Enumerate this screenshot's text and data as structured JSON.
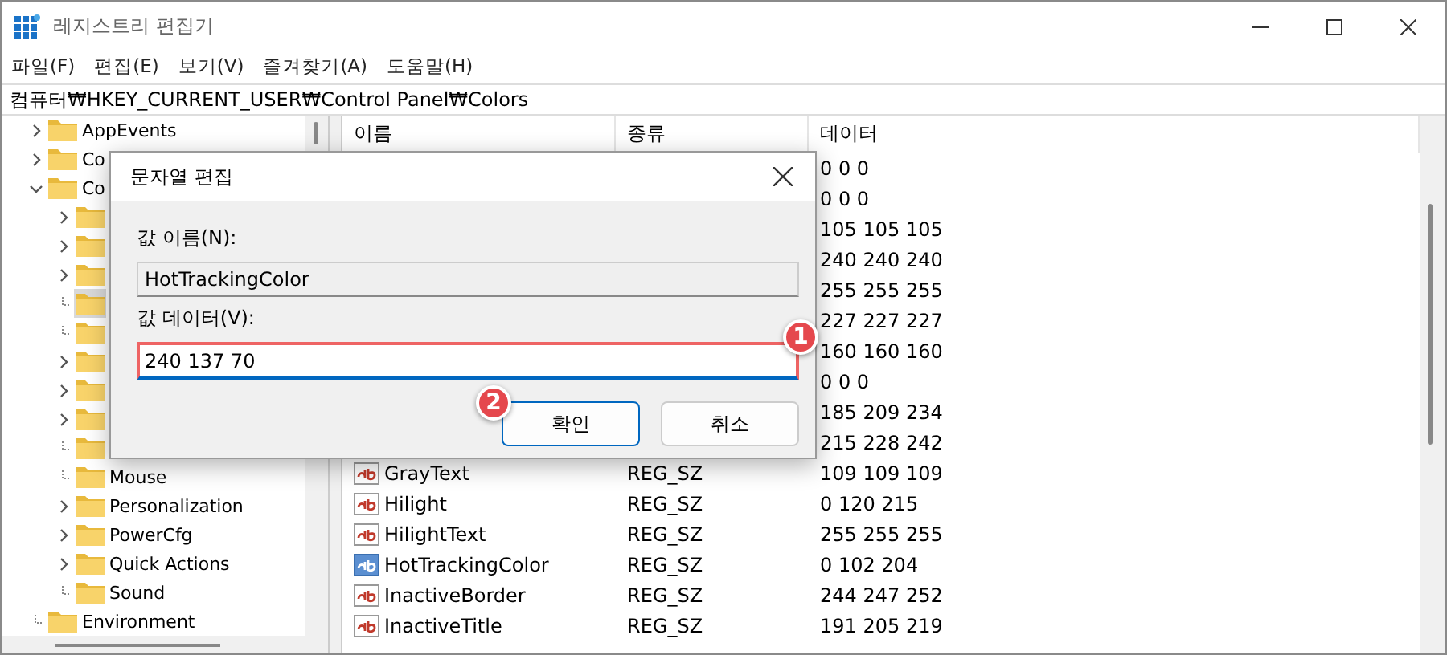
{
  "window": {
    "title": "레지스트리 편집기"
  },
  "menu": [
    "파일(F)",
    "편집(E)",
    "보기(V)",
    "즐겨찾기(A)",
    "도움말(H)"
  ],
  "address": "컴퓨터₩HKEY_CURRENT_USER₩Control Panel₩Colors",
  "tree": [
    {
      "label": "AppEvents",
      "expandable": true,
      "expanded": false,
      "selected": false
    },
    {
      "label": "Co",
      "expandable": true,
      "expanded": false,
      "selected": false
    },
    {
      "label": "Co",
      "expandable": true,
      "expanded": true,
      "selected": false,
      "children": [
        {
          "expandable": true,
          "expanded": false,
          "selected": false
        },
        {
          "expandable": true,
          "expanded": false,
          "selected": false
        },
        {
          "expandable": true,
          "expanded": false,
          "selected": false
        },
        {
          "expandable": false,
          "selected": true
        },
        {
          "expandable": false,
          "selected": false
        },
        {
          "expandable": true,
          "expanded": false,
          "selected": false
        },
        {
          "expandable": true,
          "expanded": false,
          "selected": false
        },
        {
          "expandable": true,
          "expanded": false,
          "selected": false
        },
        {
          "expandable": false,
          "selected": false
        },
        {
          "label": "Mouse",
          "expandable": false,
          "selected": false
        },
        {
          "label": "Personalization",
          "expandable": true,
          "expanded": false,
          "selected": false
        },
        {
          "label": "PowerCfg",
          "expandable": true,
          "expanded": false,
          "selected": false
        },
        {
          "label": "Quick Actions",
          "expandable": true,
          "expanded": false,
          "selected": false
        },
        {
          "label": "Sound",
          "expandable": false,
          "selected": false
        }
      ]
    },
    {
      "label": "Environment",
      "expandable": false,
      "selected": false
    }
  ],
  "table": {
    "columns": [
      "이름",
      "종류",
      "데이터"
    ],
    "rows": [
      {
        "data": "0 0 0"
      },
      {
        "data": "0 0 0"
      },
      {
        "data": "105 105 105"
      },
      {
        "data": "240 240 240"
      },
      {
        "data": "255 255 255"
      },
      {
        "data": "227 227 227"
      },
      {
        "data": "160 160 160"
      },
      {
        "data": "0 0 0"
      },
      {
        "data": "185 209 234"
      },
      {
        "data": "215 228 242"
      },
      {
        "name": "GrayText",
        "type": "REG_SZ",
        "data": "109 109 109",
        "selected": false
      },
      {
        "name": "Hilight",
        "type": "REG_SZ",
        "data": "0 120 215",
        "selected": false
      },
      {
        "name": "HilightText",
        "type": "REG_SZ",
        "data": "255 255 255",
        "selected": false
      },
      {
        "name": "HotTrackingColor",
        "type": "REG_SZ",
        "data": "0 102 204",
        "selected": true
      },
      {
        "name": "InactiveBorder",
        "type": "REG_SZ",
        "data": "244 247 252",
        "selected": false
      },
      {
        "name": "InactiveTitle",
        "type": "REG_SZ",
        "data": "191 205 219",
        "selected": false
      }
    ]
  },
  "dialog": {
    "title": "문자열 편집",
    "name_label": "값 이름(N):",
    "name_value": "HotTrackingColor",
    "data_label": "값 데이터(V):",
    "data_value": "240 137 70",
    "buttons": [
      {
        "label": "확인",
        "default": true,
        "badge": "2"
      },
      {
        "label": "취소",
        "default": false
      }
    ],
    "field_badge": "1"
  }
}
